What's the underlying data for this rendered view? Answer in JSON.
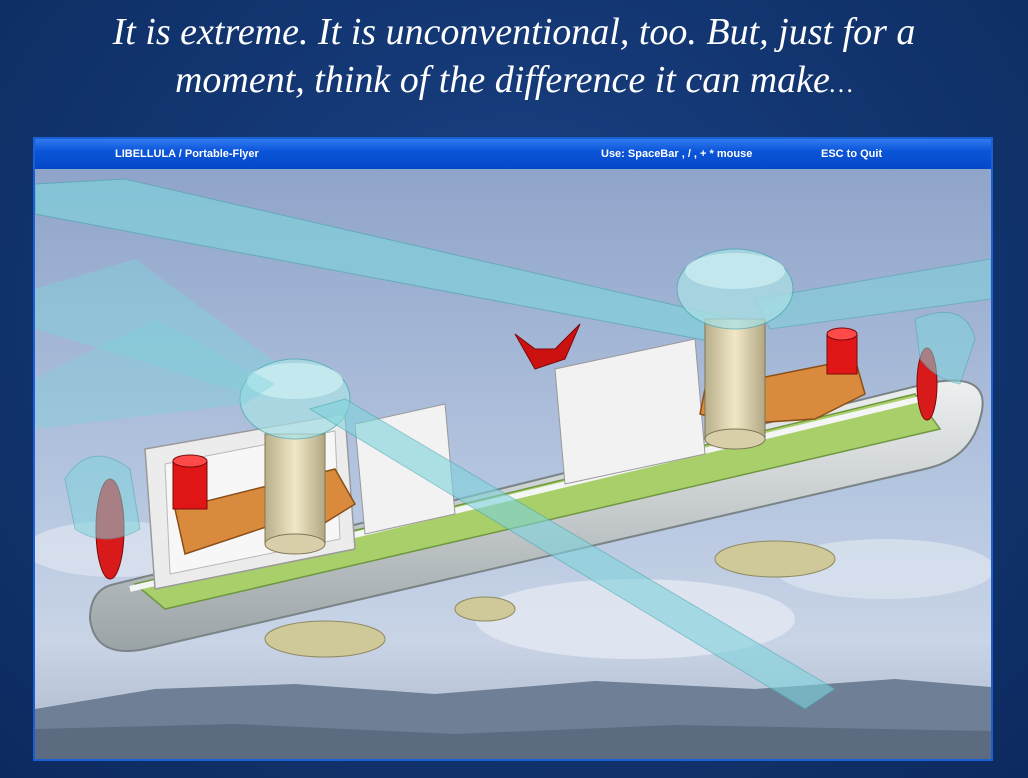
{
  "slide": {
    "caption_line1": "It is extreme. It is unconventional, too. But, just for a",
    "caption_line2": "moment, think of the difference it can make",
    "caption_ellipsis": "…"
  },
  "window": {
    "title": "LIBELLULA  /  Portable-Flyer",
    "controls_hint": "Use: SpaceBar , / , + * mouse",
    "quit_hint": "ESC to Quit"
  },
  "colors": {
    "slide_background": "#123570",
    "titlebar": "#0b55d9",
    "sky": "#9db3d6",
    "rotor_blade": "#7fd3dc",
    "deck": "#a9cf6a",
    "shell": "#cfd4d6",
    "arm": "#d98a3c",
    "red_part": "#e01515"
  },
  "scene": {
    "subject": "portable flyer tandem-rotor 3D model over sky background"
  }
}
